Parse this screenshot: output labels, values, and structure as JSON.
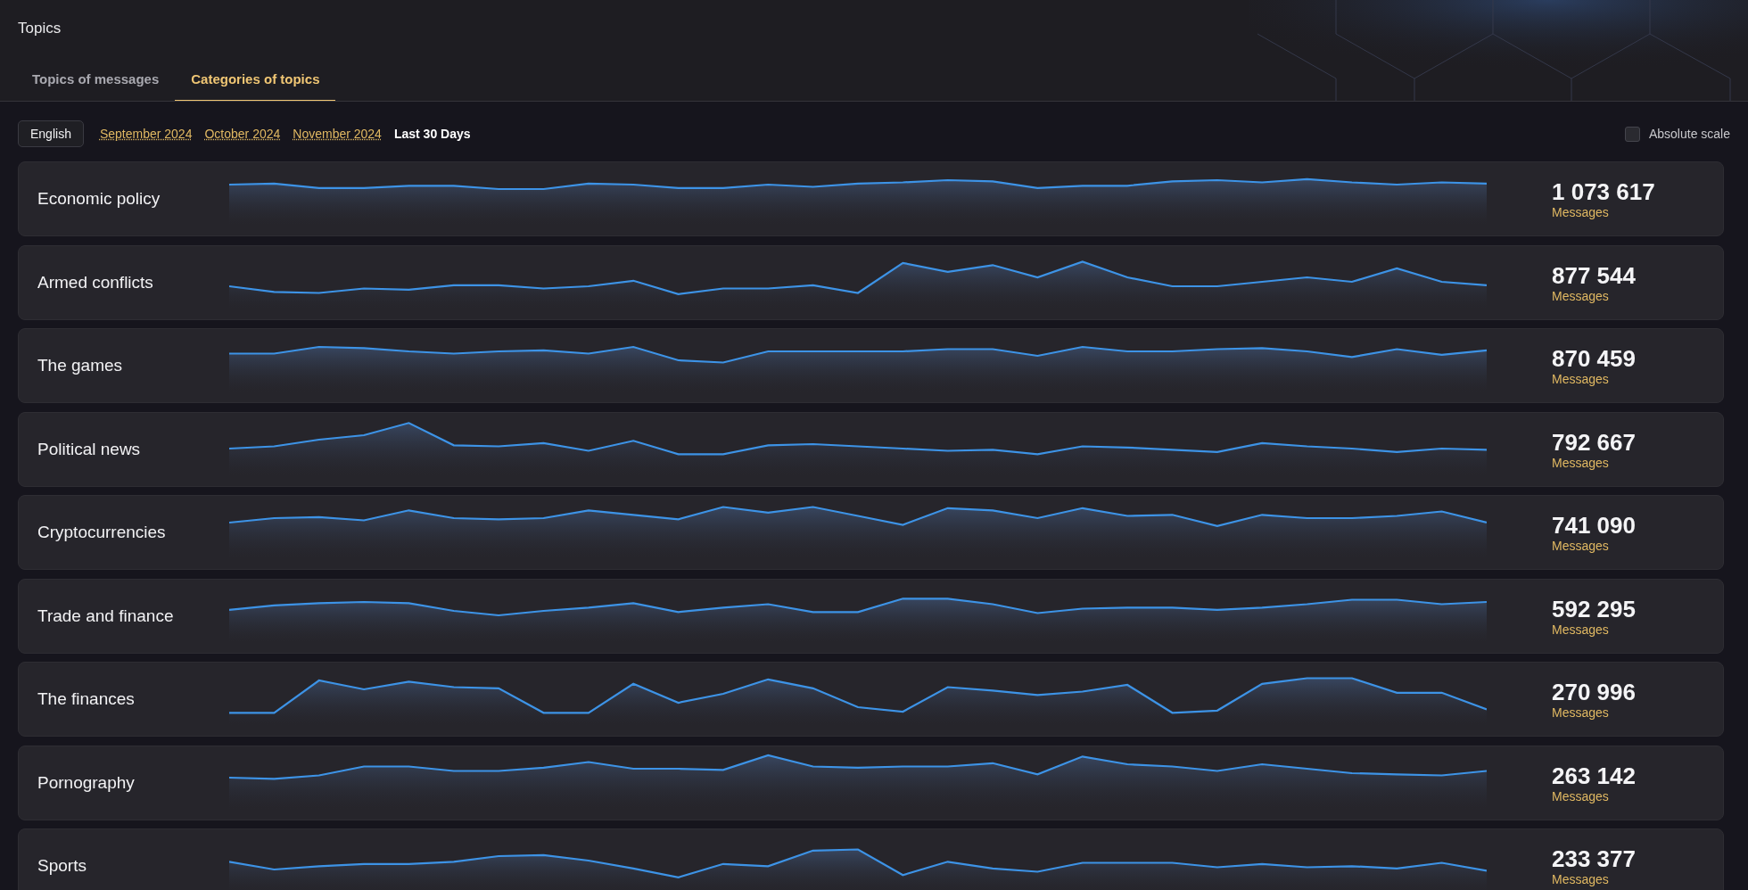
{
  "page_title": "Topics",
  "tabs": [
    {
      "label": "Topics of messages",
      "selected": false
    },
    {
      "label": "Categories of topics",
      "selected": true
    }
  ],
  "language": "English",
  "periods": [
    {
      "label": "September 2024",
      "selected": false
    },
    {
      "label": "October 2024",
      "selected": false
    },
    {
      "label": "November 2024",
      "selected": false
    },
    {
      "label": "Last 30 Days",
      "selected": true
    }
  ],
  "absolute_scale": {
    "label": "Absolute scale",
    "checked": false
  },
  "topics": [
    {
      "name": "Economic policy",
      "count": "1 073 617",
      "unit": "Messages"
    },
    {
      "name": "Armed conflicts",
      "count": "877 544",
      "unit": "Messages"
    },
    {
      "name": "The games",
      "count": "870 459",
      "unit": "Messages"
    },
    {
      "name": "Political news",
      "count": "792 667",
      "unit": "Messages"
    },
    {
      "name": "Cryptocurrencies",
      "count": "741 090",
      "unit": "Messages"
    },
    {
      "name": "Trade and finance",
      "count": "592 295",
      "unit": "Messages"
    },
    {
      "name": "The finances",
      "count": "270 996",
      "unit": "Messages"
    },
    {
      "name": "Pornography",
      "count": "263 142",
      "unit": "Messages"
    },
    {
      "name": "Sports",
      "count": "233 377",
      "unit": "Messages"
    }
  ]
}
